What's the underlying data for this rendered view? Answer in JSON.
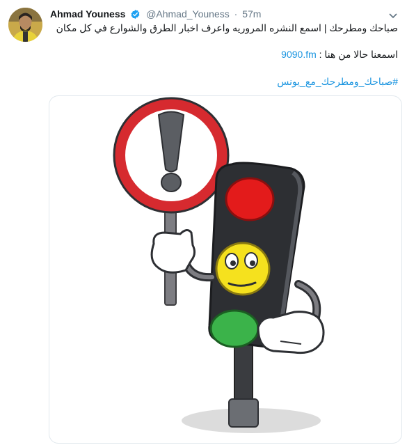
{
  "tweet": {
    "author_name": "Ahmad Youness",
    "handle": "@Ahmad_Youness",
    "separator": "·",
    "timestamp": "57m",
    "text_line1": "صباحك ومطرحك | اسمع النشره المروريه واعرف اخبار الطرق والشوارع في كل مكان",
    "text_line2_prefix": "اسمعنا حالا من هنا :",
    "link": "9090.fm",
    "hashtag": "#صباحك_ومطرحك_مع_يونس"
  },
  "icons": {
    "verified": "verified-badge-icon",
    "caret": "chevron-down-icon"
  },
  "colors": {
    "link": "#1b95e0",
    "secondary_text": "#657786",
    "verified": "#1da1f2",
    "sign_red": "#d62a2f",
    "light_red": "#e31b1b",
    "light_yellow": "#f5e11e",
    "light_green": "#3bb34a",
    "traffic_body": "#2d2f33"
  }
}
